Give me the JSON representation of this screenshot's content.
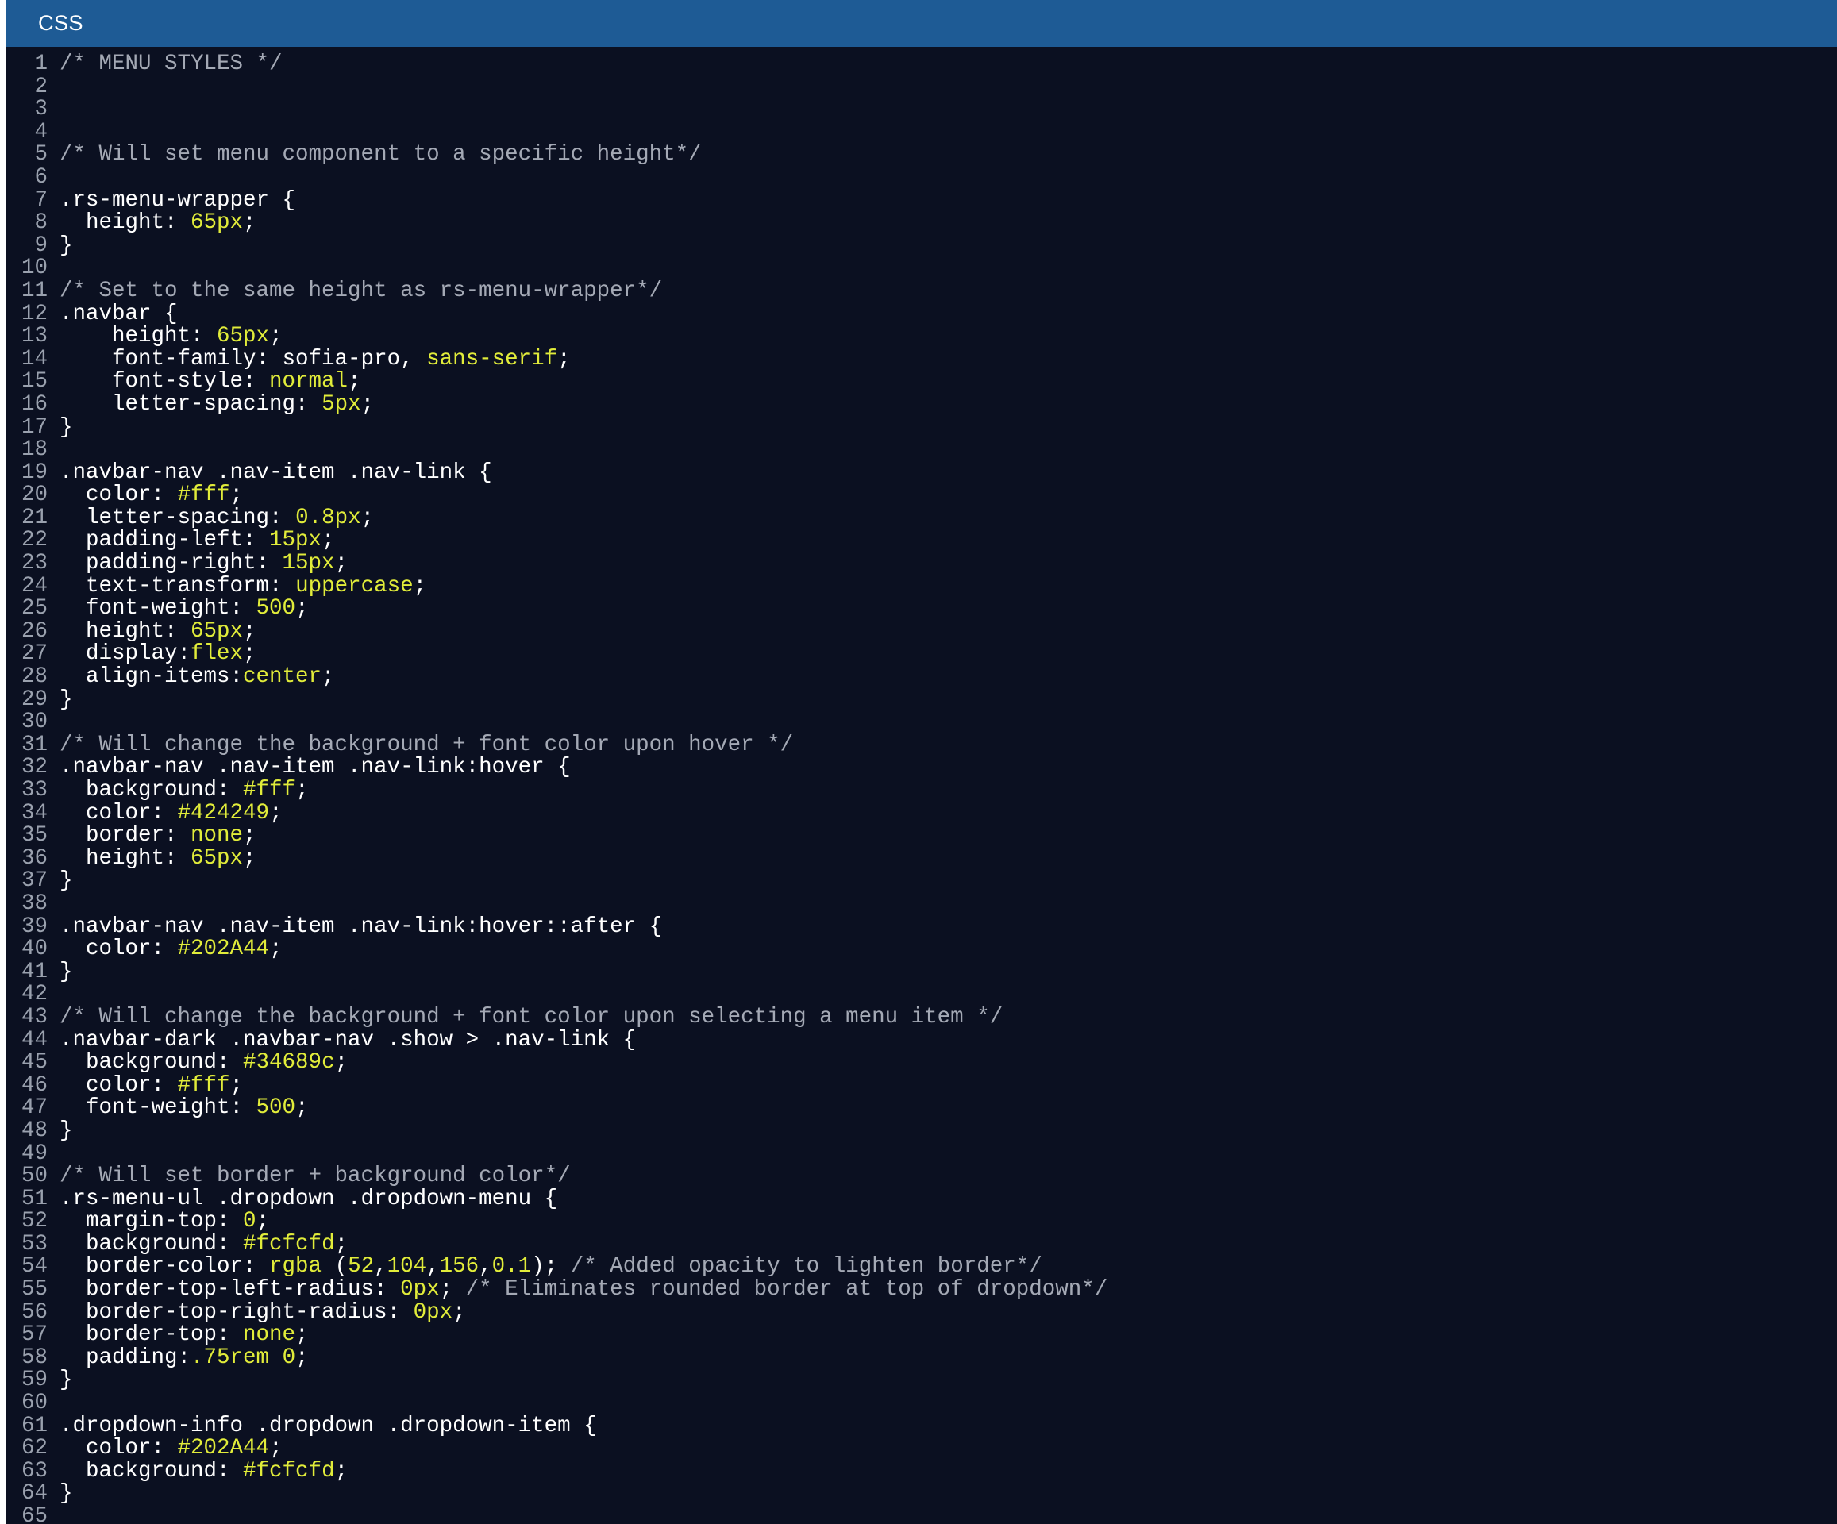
{
  "panel": {
    "title": "CSS"
  },
  "colors": {
    "header_bg": "#1e5b95",
    "editor_bg": "#0b1021",
    "plain": "#ffffff",
    "comment": "#a4a9b5",
    "value": "#e1ec3a",
    "line_number": "#9aa1ae"
  },
  "editor": {
    "lines": [
      {
        "n": "1",
        "t": [
          [
            "comment",
            "/* MENU STYLES */"
          ]
        ]
      },
      {
        "n": "2",
        "t": []
      },
      {
        "n": "3",
        "t": []
      },
      {
        "n": "4",
        "t": []
      },
      {
        "n": "5",
        "t": [
          [
            "comment",
            "/* Will set menu component to a specific height*/"
          ]
        ]
      },
      {
        "n": "6",
        "t": []
      },
      {
        "n": "7",
        "t": [
          [
            "plain",
            ".rs-menu-wrapper {"
          ]
        ]
      },
      {
        "n": "8",
        "t": [
          [
            "plain",
            "  height: "
          ],
          [
            "value",
            "65px"
          ],
          [
            "plain",
            ";"
          ]
        ]
      },
      {
        "n": "9",
        "t": [
          [
            "plain",
            "}"
          ]
        ]
      },
      {
        "n": "10",
        "t": []
      },
      {
        "n": "11",
        "t": [
          [
            "comment",
            "/* Set to the same height as rs-menu-wrapper*/"
          ]
        ]
      },
      {
        "n": "12",
        "t": [
          [
            "plain",
            ".navbar {"
          ]
        ]
      },
      {
        "n": "13",
        "t": [
          [
            "plain",
            "    height: "
          ],
          [
            "value",
            "65px"
          ],
          [
            "plain",
            ";"
          ]
        ]
      },
      {
        "n": "14",
        "t": [
          [
            "plain",
            "    font-family: sofia-pro, "
          ],
          [
            "value",
            "sans-serif"
          ],
          [
            "plain",
            ";"
          ]
        ]
      },
      {
        "n": "15",
        "t": [
          [
            "plain",
            "    font-style: "
          ],
          [
            "value",
            "normal"
          ],
          [
            "plain",
            ";"
          ]
        ]
      },
      {
        "n": "16",
        "t": [
          [
            "plain",
            "    letter-spacing: "
          ],
          [
            "value",
            "5px"
          ],
          [
            "plain",
            ";"
          ]
        ]
      },
      {
        "n": "17",
        "t": [
          [
            "plain",
            "}"
          ]
        ]
      },
      {
        "n": "18",
        "t": []
      },
      {
        "n": "19",
        "t": [
          [
            "plain",
            ".navbar-nav .nav-item .nav-link {"
          ]
        ]
      },
      {
        "n": "20",
        "t": [
          [
            "plain",
            "  color: "
          ],
          [
            "value",
            "#fff"
          ],
          [
            "plain",
            ";"
          ]
        ]
      },
      {
        "n": "21",
        "t": [
          [
            "plain",
            "  letter-spacing: "
          ],
          [
            "value",
            "0.8px"
          ],
          [
            "plain",
            ";"
          ]
        ]
      },
      {
        "n": "22",
        "t": [
          [
            "plain",
            "  padding-left: "
          ],
          [
            "value",
            "15px"
          ],
          [
            "plain",
            ";"
          ]
        ]
      },
      {
        "n": "23",
        "t": [
          [
            "plain",
            "  padding-right: "
          ],
          [
            "value",
            "15px"
          ],
          [
            "plain",
            ";"
          ]
        ]
      },
      {
        "n": "24",
        "t": [
          [
            "plain",
            "  text-transform: "
          ],
          [
            "value",
            "uppercase"
          ],
          [
            "plain",
            ";"
          ]
        ]
      },
      {
        "n": "25",
        "t": [
          [
            "plain",
            "  font-weight: "
          ],
          [
            "value",
            "500"
          ],
          [
            "plain",
            ";"
          ]
        ]
      },
      {
        "n": "26",
        "t": [
          [
            "plain",
            "  height: "
          ],
          [
            "value",
            "65px"
          ],
          [
            "plain",
            ";"
          ]
        ]
      },
      {
        "n": "27",
        "t": [
          [
            "plain",
            "  display:"
          ],
          [
            "value",
            "flex"
          ],
          [
            "plain",
            ";"
          ]
        ]
      },
      {
        "n": "28",
        "t": [
          [
            "plain",
            "  align-items:"
          ],
          [
            "value",
            "center"
          ],
          [
            "plain",
            ";"
          ]
        ]
      },
      {
        "n": "29",
        "t": [
          [
            "plain",
            "}"
          ]
        ]
      },
      {
        "n": "30",
        "t": []
      },
      {
        "n": "31",
        "t": [
          [
            "comment",
            "/* Will change the background + font color upon hover */"
          ]
        ]
      },
      {
        "n": "32",
        "t": [
          [
            "plain",
            ".navbar-nav .nav-item .nav-link:hover {"
          ]
        ]
      },
      {
        "n": "33",
        "t": [
          [
            "plain",
            "  background: "
          ],
          [
            "value",
            "#fff"
          ],
          [
            "plain",
            ";"
          ]
        ]
      },
      {
        "n": "34",
        "t": [
          [
            "plain",
            "  color: "
          ],
          [
            "value",
            "#424249"
          ],
          [
            "plain",
            ";"
          ]
        ]
      },
      {
        "n": "35",
        "t": [
          [
            "plain",
            "  border: "
          ],
          [
            "value",
            "none"
          ],
          [
            "plain",
            ";"
          ]
        ]
      },
      {
        "n": "36",
        "t": [
          [
            "plain",
            "  height: "
          ],
          [
            "value",
            "65px"
          ],
          [
            "plain",
            ";"
          ]
        ]
      },
      {
        "n": "37",
        "t": [
          [
            "plain",
            "}"
          ]
        ]
      },
      {
        "n": "38",
        "t": []
      },
      {
        "n": "39",
        "t": [
          [
            "plain",
            ".navbar-nav .nav-item .nav-link:hover::after {"
          ]
        ]
      },
      {
        "n": "40",
        "t": [
          [
            "plain",
            "  color: "
          ],
          [
            "value",
            "#202A44"
          ],
          [
            "plain",
            ";"
          ]
        ]
      },
      {
        "n": "41",
        "t": [
          [
            "plain",
            "}"
          ]
        ]
      },
      {
        "n": "42",
        "t": []
      },
      {
        "n": "43",
        "t": [
          [
            "comment",
            "/* Will change the background + font color upon selecting a menu item */"
          ]
        ]
      },
      {
        "n": "44",
        "t": [
          [
            "plain",
            ".navbar-dark .navbar-nav .show > .nav-link {"
          ]
        ]
      },
      {
        "n": "45",
        "t": [
          [
            "plain",
            "  background: "
          ],
          [
            "value",
            "#34689c"
          ],
          [
            "plain",
            ";"
          ]
        ]
      },
      {
        "n": "46",
        "t": [
          [
            "plain",
            "  color: "
          ],
          [
            "value",
            "#fff"
          ],
          [
            "plain",
            ";"
          ]
        ]
      },
      {
        "n": "47",
        "t": [
          [
            "plain",
            "  font-weight: "
          ],
          [
            "value",
            "500"
          ],
          [
            "plain",
            ";"
          ]
        ]
      },
      {
        "n": "48",
        "t": [
          [
            "plain",
            "}"
          ]
        ]
      },
      {
        "n": "49",
        "t": []
      },
      {
        "n": "50",
        "t": [
          [
            "comment",
            "/* Will set border + background color*/"
          ]
        ]
      },
      {
        "n": "51",
        "t": [
          [
            "plain",
            ".rs-menu-ul .dropdown .dropdown-menu {"
          ]
        ]
      },
      {
        "n": "52",
        "t": [
          [
            "plain",
            "  margin-top: "
          ],
          [
            "value",
            "0"
          ],
          [
            "plain",
            ";"
          ]
        ]
      },
      {
        "n": "53",
        "t": [
          [
            "plain",
            "  background: "
          ],
          [
            "value",
            "#fcfcfd"
          ],
          [
            "plain",
            ";"
          ]
        ]
      },
      {
        "n": "54",
        "t": [
          [
            "plain",
            "  border-color: "
          ],
          [
            "value",
            "rgba"
          ],
          [
            "plain",
            " ("
          ],
          [
            "value",
            "52"
          ],
          [
            "plain",
            ","
          ],
          [
            "value",
            "104"
          ],
          [
            "plain",
            ","
          ],
          [
            "value",
            "156"
          ],
          [
            "plain",
            ","
          ],
          [
            "value",
            "0.1"
          ],
          [
            "plain",
            "); "
          ],
          [
            "comment",
            "/* Added opacity to lighten border*/"
          ]
        ]
      },
      {
        "n": "55",
        "t": [
          [
            "plain",
            "  border-top-left-radius: "
          ],
          [
            "value",
            "0px"
          ],
          [
            "plain",
            "; "
          ],
          [
            "comment",
            "/* Eliminates rounded border at top of dropdown*/"
          ]
        ]
      },
      {
        "n": "56",
        "t": [
          [
            "plain",
            "  border-top-right-radius: "
          ],
          [
            "value",
            "0px"
          ],
          [
            "plain",
            ";"
          ]
        ]
      },
      {
        "n": "57",
        "t": [
          [
            "plain",
            "  border-top: "
          ],
          [
            "value",
            "none"
          ],
          [
            "plain",
            ";"
          ]
        ]
      },
      {
        "n": "58",
        "t": [
          [
            "plain",
            "  padding:"
          ],
          [
            "value",
            ".75rem"
          ],
          [
            "plain",
            " "
          ],
          [
            "value",
            "0"
          ],
          [
            "plain",
            ";"
          ]
        ]
      },
      {
        "n": "59",
        "t": [
          [
            "plain",
            "}"
          ]
        ]
      },
      {
        "n": "60",
        "t": []
      },
      {
        "n": "61",
        "t": [
          [
            "plain",
            ".dropdown-info .dropdown .dropdown-item {"
          ]
        ]
      },
      {
        "n": "62",
        "t": [
          [
            "plain",
            "  color: "
          ],
          [
            "value",
            "#202A44"
          ],
          [
            "plain",
            ";"
          ]
        ]
      },
      {
        "n": "63",
        "t": [
          [
            "plain",
            "  background: "
          ],
          [
            "value",
            "#fcfcfd"
          ],
          [
            "plain",
            ";"
          ]
        ]
      },
      {
        "n": "64",
        "t": [
          [
            "plain",
            "}"
          ]
        ]
      },
      {
        "n": "65",
        "t": []
      }
    ]
  }
}
